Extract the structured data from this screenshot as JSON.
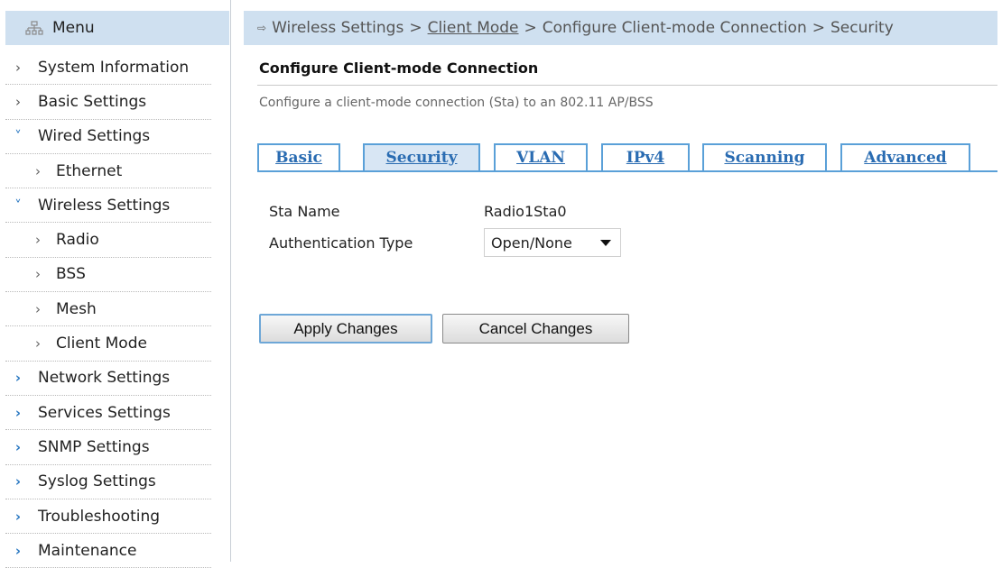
{
  "sidebar": {
    "menu_title": "Menu",
    "items": [
      {
        "label": "System Information",
        "level": 0,
        "expanded": false
      },
      {
        "label": "Basic Settings",
        "level": 0,
        "expanded": false
      },
      {
        "label": "Wired Settings",
        "level": 0,
        "expanded": true
      },
      {
        "label": "Ethernet",
        "level": 1,
        "expanded": false
      },
      {
        "label": "Wireless Settings",
        "level": 0,
        "expanded": true
      },
      {
        "label": "Radio",
        "level": 1,
        "expanded": false
      },
      {
        "label": "BSS",
        "level": 1,
        "expanded": false
      },
      {
        "label": "Mesh",
        "level": 1,
        "expanded": false
      },
      {
        "label": "Client Mode",
        "level": 1,
        "expanded": false
      },
      {
        "label": "Network Settings",
        "level": 0,
        "expanded": false
      },
      {
        "label": "Services Settings",
        "level": 0,
        "expanded": false
      },
      {
        "label": "SNMP Settings",
        "level": 0,
        "expanded": false
      },
      {
        "label": "Syslog Settings",
        "level": 0,
        "expanded": false
      },
      {
        "label": "Troubleshooting",
        "level": 0,
        "expanded": false
      },
      {
        "label": "Maintenance",
        "level": 0,
        "expanded": false
      }
    ]
  },
  "breadcrumb": {
    "parts": [
      "Wireless Settings",
      "Client Mode",
      "Configure Client-mode Connection",
      "Security"
    ],
    "separator": ">"
  },
  "page": {
    "title": "Configure Client-mode Connection",
    "description": "Configure a client-mode connection (Sta) to an 802.11 AP/BSS"
  },
  "tabs": [
    {
      "label": "Basic",
      "active": false
    },
    {
      "label": "Security",
      "active": true
    },
    {
      "label": "VLAN",
      "active": false
    },
    {
      "label": "IPv4",
      "active": false
    },
    {
      "label": "Scanning",
      "active": false
    },
    {
      "label": "Advanced",
      "active": false
    }
  ],
  "form": {
    "sta_name_label": "Sta Name",
    "sta_name_value": "Radio1Sta0",
    "auth_type_label": "Authentication Type",
    "auth_type_value": "Open/None"
  },
  "buttons": {
    "apply": "Apply Changes",
    "cancel": "Cancel Changes"
  },
  "colors": {
    "header_bg": "#cfe0f0",
    "tab_border": "#5aa0d8",
    "tab_text": "#2a6cb2",
    "active_tab_bg": "#d8e6f4"
  }
}
